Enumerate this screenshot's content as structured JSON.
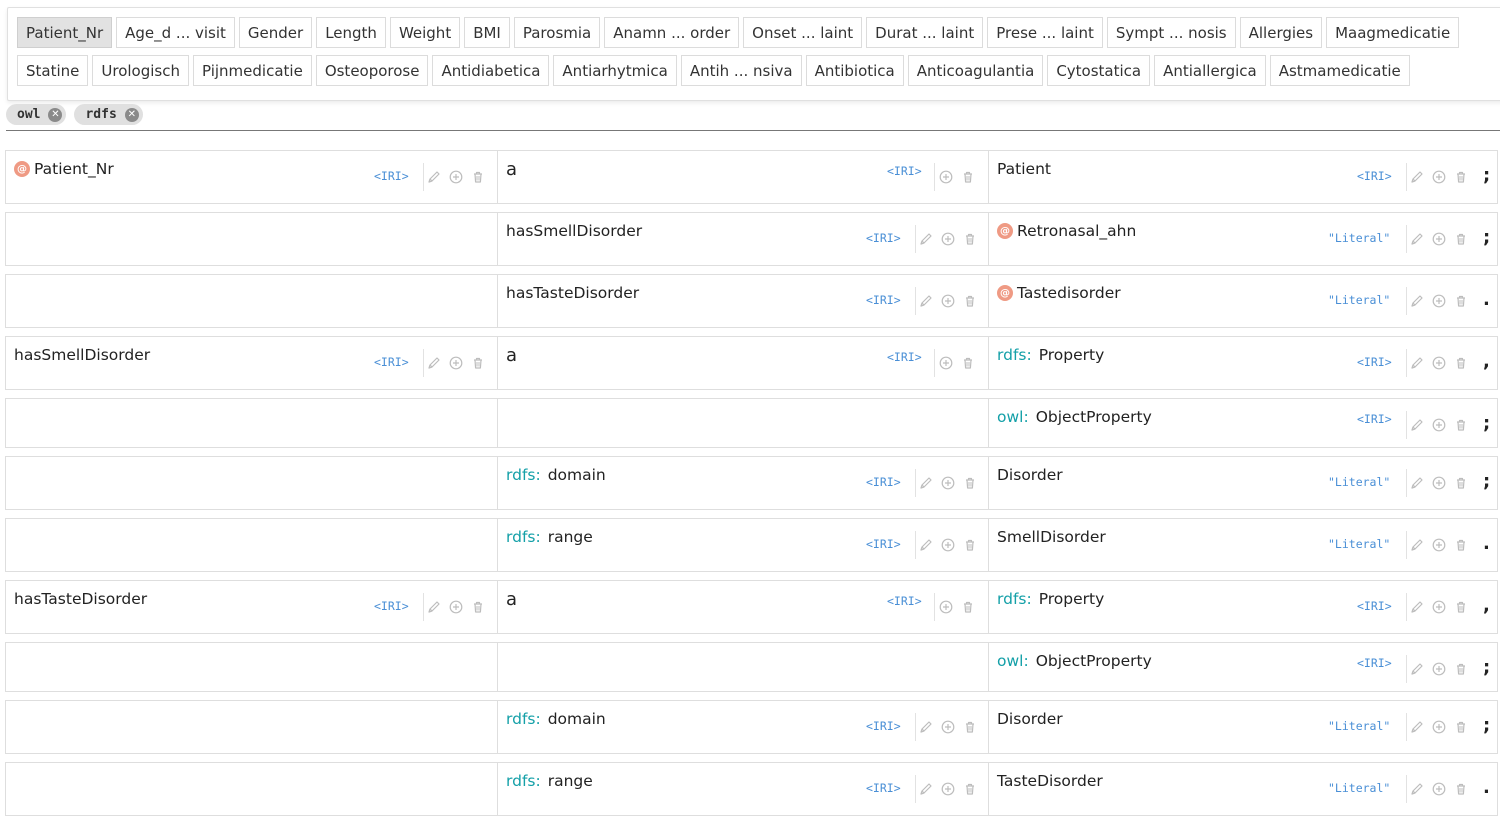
{
  "columns": {
    "row1": [
      "Patient_Nr",
      "Age_d ... visit",
      "Gender",
      "Length",
      "Weight",
      "BMI",
      "Parosmia",
      "Anamn ... order",
      "Onset ... laint",
      "Durat ... laint",
      "Prese ... laint",
      "Sympt ... nosis",
      "Allergies",
      "Maagmedicatie"
    ],
    "row2": [
      "Statine",
      "Urologisch",
      "Pijnmedicatie",
      "Osteoporose",
      "Antidiabetica",
      "Antiarhytmica",
      "Antih ... nsiva",
      "Antibiotica",
      "Anticoagulantia",
      "Cytostatica",
      "Antiallergica",
      "Astmamedicatie"
    ],
    "active": "Patient_Nr"
  },
  "prefixes": [
    "owl",
    "rdfs"
  ],
  "tags": {
    "iri": "<IRI>",
    "literal": "\"Literal\""
  },
  "icons": {
    "resource": "at-sign-icon",
    "edit": "pencil-icon",
    "add": "plus-circle-icon",
    "delete": "trash-icon",
    "remove_prefix": "close-icon"
  },
  "triples": [
    {
      "s": "Patient_Nr",
      "s_res": true,
      "s_tag": "<IRI>",
      "p": "a",
      "p_big": true,
      "p_tag": "<IRI>",
      "o": "Patient",
      "o_tag": "<IRI>",
      "end": ";"
    },
    {
      "p": "hasSmellDisorder",
      "p_tag": "<IRI>",
      "o": "Retronasal_ahn",
      "o_res": true,
      "o_tag": "\"Literal\"",
      "end": ";"
    },
    {
      "p": "hasTasteDisorder",
      "p_tag": "<IRI>",
      "o": "Tastedisorder",
      "o_res": true,
      "o_tag": "\"Literal\"",
      "end": "."
    },
    {
      "s": "hasSmellDisorder",
      "s_tag": "<IRI>",
      "p": "a",
      "p_big": true,
      "p_tag": "<IRI>",
      "o_pref": "rdfs:",
      "o": "Property",
      "o_tag": "<IRI>",
      "end": ","
    },
    {
      "o_pref": "owl:",
      "o": "ObjectProperty",
      "o_tag": "<IRI>",
      "end": ";"
    },
    {
      "p_pref": "rdfs:",
      "p": "domain",
      "p_tag": "<IRI>",
      "o": "Disorder",
      "o_tag": "\"Literal\"",
      "end": ";"
    },
    {
      "p_pref": "rdfs:",
      "p": "range",
      "p_tag": "<IRI>",
      "o": "SmellDisorder",
      "o_tag": "\"Literal\"",
      "end": "."
    },
    {
      "s": "hasTasteDisorder",
      "s_tag": "<IRI>",
      "p": "a",
      "p_big": true,
      "p_tag": "<IRI>",
      "o_pref": "rdfs:",
      "o": "Property",
      "o_tag": "<IRI>",
      "end": ","
    },
    {
      "o_pref": "owl:",
      "o": "ObjectProperty",
      "o_tag": "<IRI>",
      "end": ";"
    },
    {
      "p_pref": "rdfs:",
      "p": "domain",
      "p_tag": "<IRI>",
      "o": "Disorder",
      "o_tag": "\"Literal\"",
      "end": ";"
    },
    {
      "p_pref": "rdfs:",
      "p": "range",
      "p_tag": "<IRI>",
      "o": "TasteDisorder",
      "o_tag": "\"Literal\"",
      "end": "."
    }
  ]
}
